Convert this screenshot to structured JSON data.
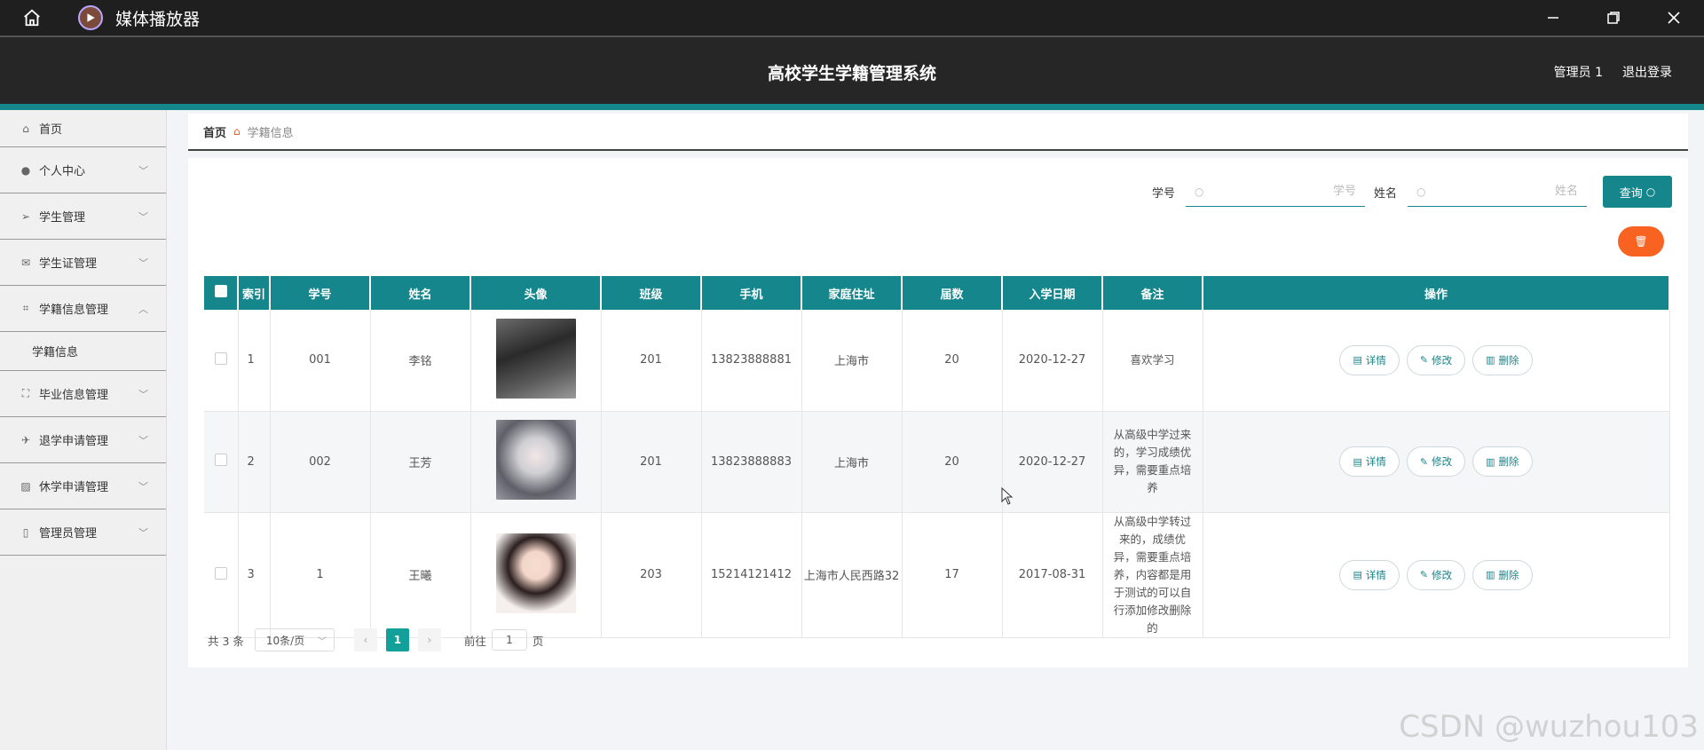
{
  "window": {
    "title": "媒体播放器"
  },
  "header": {
    "system_title": "高校学生学籍管理系统",
    "user": "管理员 1",
    "logout": "退出登录"
  },
  "sidebar": {
    "items": [
      {
        "label": "首页"
      },
      {
        "label": "个人中心"
      },
      {
        "label": "学生管理"
      },
      {
        "label": "学生证管理"
      },
      {
        "label": "学籍信息管理"
      },
      {
        "label": "学籍信息"
      },
      {
        "label": "毕业信息管理"
      },
      {
        "label": "退学申请管理"
      },
      {
        "label": "休学申请管理"
      },
      {
        "label": "管理员管理"
      }
    ]
  },
  "breadcrumb": {
    "home": "首页",
    "current": "学籍信息"
  },
  "search": {
    "student_no_label": "学号",
    "student_no_placeholder": "学号",
    "name_label": "姓名",
    "name_placeholder": "姓名",
    "query_button": "查询"
  },
  "table": {
    "columns": [
      "索引",
      "学号",
      "姓名",
      "头像",
      "班级",
      "手机",
      "家庭住址",
      "届数",
      "入学日期",
      "备注",
      "操作"
    ],
    "rows": [
      {
        "index": "1",
        "student_no": "001",
        "name": "李铭",
        "class": "201",
        "phone": "13823888881",
        "address": "上海市",
        "session": "20",
        "date": "2020-12-27",
        "note": "喜欢学习"
      },
      {
        "index": "2",
        "student_no": "002",
        "name": "王芳",
        "class": "201",
        "phone": "13823888883",
        "address": "上海市",
        "session": "20",
        "date": "2020-12-27",
        "note": "从高级中学过来的，学习成绩优异，需要重点培养"
      },
      {
        "index": "3",
        "student_no": "1",
        "name": "王曦",
        "class": "203",
        "phone": "15214121412",
        "address": "上海市人民西路32",
        "session": "17",
        "date": "2017-08-31",
        "note": "从高级中学转过来的，成绩优异，需要重点培养，内容都是用于测试的可以自行添加修改删除的"
      }
    ],
    "actions": {
      "detail": "详情",
      "edit": "修改",
      "delete": "删除"
    }
  },
  "pager": {
    "total": "共 3 条",
    "page_size": "10条/页",
    "current_page": "1",
    "goto_label": "前往",
    "goto_value": "1",
    "page_unit": "页"
  },
  "watermark": "CSDN @wuzhou103",
  "colors": {
    "accent": "#14868c",
    "danger": "#f86322",
    "header_bg": "#262626"
  }
}
